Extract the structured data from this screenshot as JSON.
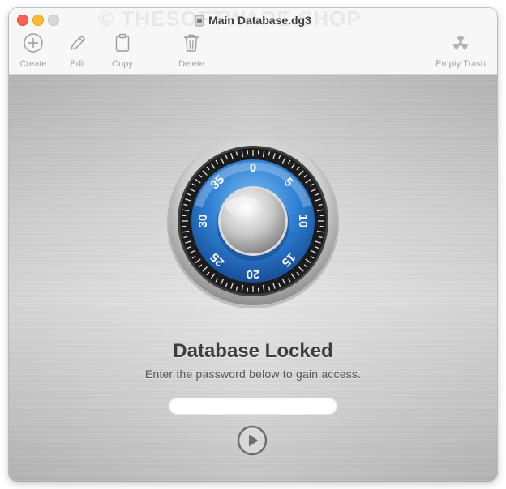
{
  "window": {
    "title": "Main Database.dg3",
    "watermark": "© THESOFTWARE.SHOP"
  },
  "toolbar": {
    "create_label": "Create",
    "edit_label": "Edit",
    "copy_label": "Copy",
    "delete_label": "Delete",
    "empty_trash_label": "Empty Trash"
  },
  "lock_screen": {
    "heading": "Database Locked",
    "subtext": "Enter the password below to gain access.",
    "password_value": "",
    "password_placeholder": "",
    "dial_numbers": [
      "0",
      "5",
      "10",
      "15",
      "20",
      "25",
      "30",
      "35"
    ]
  },
  "icons": {
    "create": "plus-circle-icon",
    "edit": "pencil-icon",
    "copy": "clipboard-icon",
    "delete": "trash-icon",
    "empty_trash": "radiation-icon",
    "submit": "play-circle-icon"
  },
  "colors": {
    "close": "#fe5f57",
    "minimize": "#febc2e",
    "maximize": "#d8d8d8",
    "dial_blue": "#2f7fd3"
  }
}
